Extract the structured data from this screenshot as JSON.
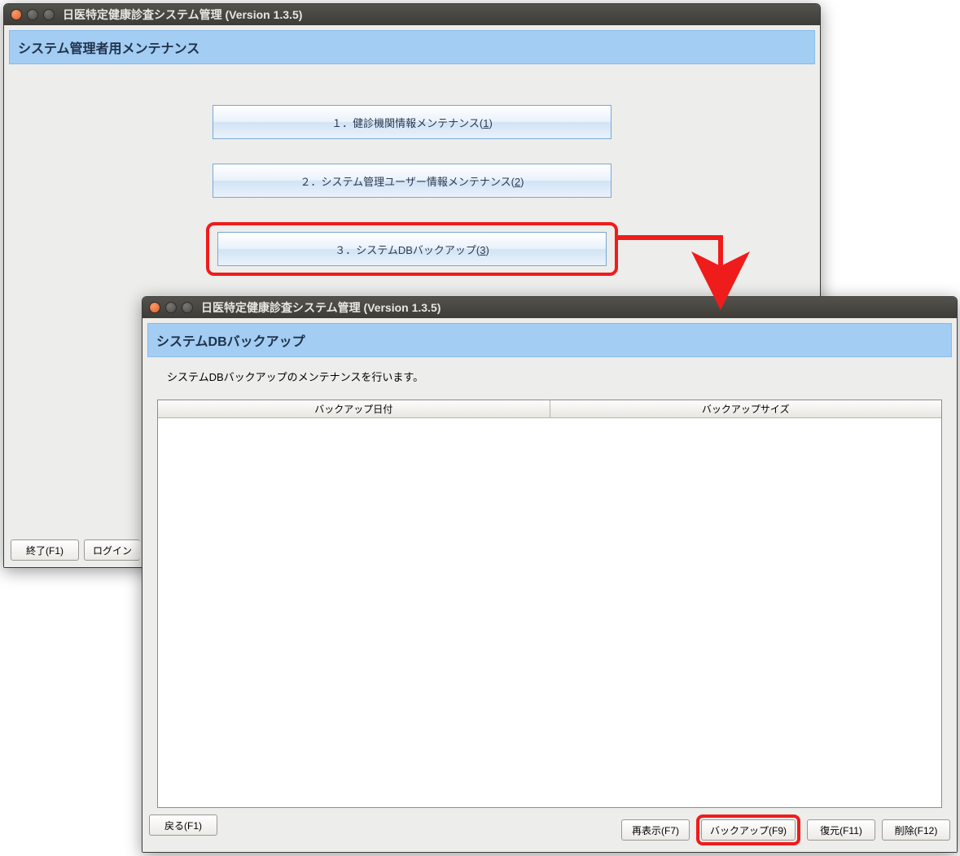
{
  "window1": {
    "title": "日医特定健康診査システム管理 (Version 1.3.5)",
    "section_title": "システム管理者用メンテナンス",
    "menu": {
      "item1_prefix": "１．健診機関情報メンテナンス(",
      "item1_key": "1",
      "item1_suffix": ")",
      "item2_prefix": "２．システム管理ユーザー情報メンテナンス(",
      "item2_key": "2",
      "item2_suffix": ")",
      "item3_prefix": "３．システムDBバックアップ(",
      "item3_key": "3",
      "item3_suffix": ")"
    },
    "footer": {
      "exit": "終了(F1)",
      "login": "ログイン"
    }
  },
  "window2": {
    "title": "日医特定健康診査システム管理 (Version 1.3.5)",
    "section_title": "システムDBバックアップ",
    "description": "システムDBバックアップのメンテナンスを行います。",
    "table": {
      "col1": "バックアップ日付",
      "col2": "バックアップサイズ"
    },
    "footer": {
      "back": "戻る(F1)",
      "refresh": "再表示(F7)",
      "backup": "バックアップ(F9)",
      "restore": "復元(F11)",
      "delete": "削除(F12)"
    }
  }
}
